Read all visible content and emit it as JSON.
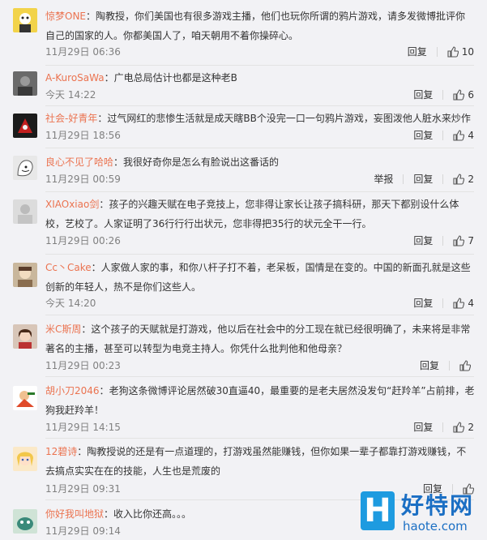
{
  "comments": [
    {
      "user": "惊梦ONE",
      "text": "陶教授，你们美国也有很多游戏主播，他们也玩你所谓的鸦片游戏，请多发微博批评你自己的国家的人。你都美国人了，咱天朝用不着你操碎心。",
      "time": "11月29日 06:36",
      "reply": "回复",
      "likes": "10",
      "report": ""
    },
    {
      "user": "A-KuroSaWa",
      "text": "广电总局估计也都是这种老B",
      "time": "今天 14:22",
      "reply": "回复",
      "likes": "6",
      "report": ""
    },
    {
      "user": "社会-好青年",
      "text": "过气网红的悲惨生活就是成天瞎BB个没完一口一句鸦片游戏，妄图泼他人脏水来炒作",
      "time": "11月29日 18:56",
      "reply": "回复",
      "likes": "4",
      "report": ""
    },
    {
      "user": "良心不见了哈哈",
      "text": "我很好奇你是怎么有脸说出这番话的",
      "time": "11月29日 00:59",
      "reply": "回复",
      "likes": "2",
      "report": "举报"
    },
    {
      "user": "XIAOxiao剑",
      "text": "孩子的兴趣天赋在电子竞技上，您非得让家长让孩子搞科研，那天下都别设什么体校，艺校了。人家证明了36行行行出状元，您非得把35行的状元全干一行。",
      "time": "11月29日 00:26",
      "reply": "回复",
      "likes": "7",
      "report": ""
    },
    {
      "user": "Cc丶Cake",
      "text": "人家做人家的事，和你八杆子打不着，老呆板，国情是在变的。中国的新面孔就是这些创新的年轻人，热不是你们这些人。",
      "time": "今天 14:20",
      "reply": "回复",
      "likes": "4",
      "report": ""
    },
    {
      "user": "米C斯周",
      "text": "这个孩子的天赋就是打游戏，他以后在社会中的分工现在就已经很明确了，未来将是非常著名的主播，甚至可以转型为电竞主持人。你凭什么批判他和他母亲？",
      "time": "11月29日 00:23",
      "reply": "回复",
      "likes": "",
      "report": ""
    },
    {
      "user": "胡小刀2046",
      "text": "老狗这条微博评论居然破30直逼40，最重要的是老夫居然没发句“赶羚羊”占前排，老狗我赶羚羊！",
      "time": "11月29日 14:15",
      "reply": "回复",
      "likes": "2",
      "report": ""
    },
    {
      "user": "12碧诗",
      "text": "陶教授说的还是有一点道理的，打游戏虽然能赚钱，但你如果一辈子都靠打游戏赚钱，不去搞点实实在在的技能，人生也是荒废的",
      "time": "11月29日 09:31",
      "reply": "回复",
      "likes": "",
      "report": ""
    },
    {
      "user": "你好我叫地狱",
      "text": "收入比你还高。。。",
      "time": "11月29日 09:14",
      "reply": "",
      "likes": "",
      "report": ""
    }
  ],
  "watermark": {
    "letter": "H",
    "title": "好特网",
    "url": "haote.com"
  },
  "colors": {
    "username_orange": "#eb7350",
    "username_blue": "#3e7ebd",
    "timestamp": "#808080",
    "background": "#f2f2f5",
    "watermark_blue": "#1b6fc4"
  }
}
